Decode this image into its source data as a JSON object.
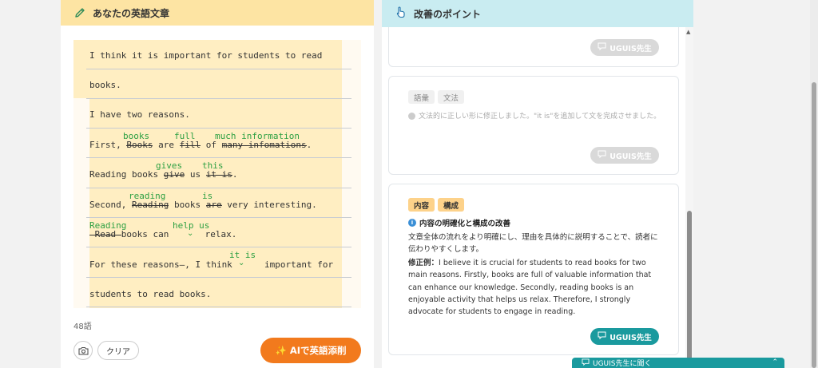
{
  "left": {
    "title": "あなたの英語文章",
    "lines": [
      {
        "plain": "I think it is important for students to read"
      },
      {
        "plain": "books."
      },
      {
        "plain": "I have two reasons."
      },
      {
        "a": "First, ",
        "s1": "Books",
        "b": " are ",
        "s2": "fill",
        "c": " of ",
        "s3": "many infomations",
        "d": "."
      },
      {
        "a": "Reading books ",
        "s1": "give",
        "b": " us ",
        "s2": "it is",
        "c": "."
      },
      {
        "a": "Second, ",
        "s1": "Reading",
        "b": " books ",
        "s2": "are",
        "c": " very interesting."
      },
      {
        "s1": " Read ",
        "a": "books can ",
        "b": " relax."
      },
      {
        "a": "For these reasons–, I think ",
        "b": " important for"
      },
      {
        "plain": "students to read books."
      }
    ],
    "corrections": {
      "l4_1": "books",
      "l4_2": "full",
      "l4_3": "much information",
      "l5_1": "gives",
      "l5_2": "this",
      "l6_1": "reading",
      "l6_2": "is",
      "l7_1": "Reading",
      "l7_2": "help us",
      "l8_1": "it is"
    },
    "word_count": "48語",
    "clear_label": "クリア",
    "ai_button_label": "AIで英語添削"
  },
  "right": {
    "title": "改善のポイント",
    "uguis_label": "UGUIS先生",
    "card2": {
      "tags": [
        "語彙",
        "文法"
      ],
      "text": "文法的に正しい形に修正しました。\"it is\"を追加して文を完成させました。"
    },
    "card3": {
      "tags": [
        "内容",
        "構成"
      ],
      "heading": "内容の明確化と構成の改善",
      "body": "文章全体の流れをより明確にし、理由を具体的に説明することで、読者に伝わりやすくします。",
      "example_label": "修正例：",
      "example": "I believe it is crucial for students to read books for two main reasons. Firstly, books are full of valuable information that can enhance our knowledge. Secondly, reading books is an enjoyable activity that helps us relax. Therefore, I strongly advocate for students to engage in reading."
    },
    "ask_label": "UGUIS先生に聞く"
  },
  "colors": {
    "accent_orange": "#f27a1d",
    "teal": "#1a9a9e",
    "correction_green": "#2ea043",
    "header_yellow": "#fde4a3",
    "header_cyan": "#c9ecf1"
  }
}
